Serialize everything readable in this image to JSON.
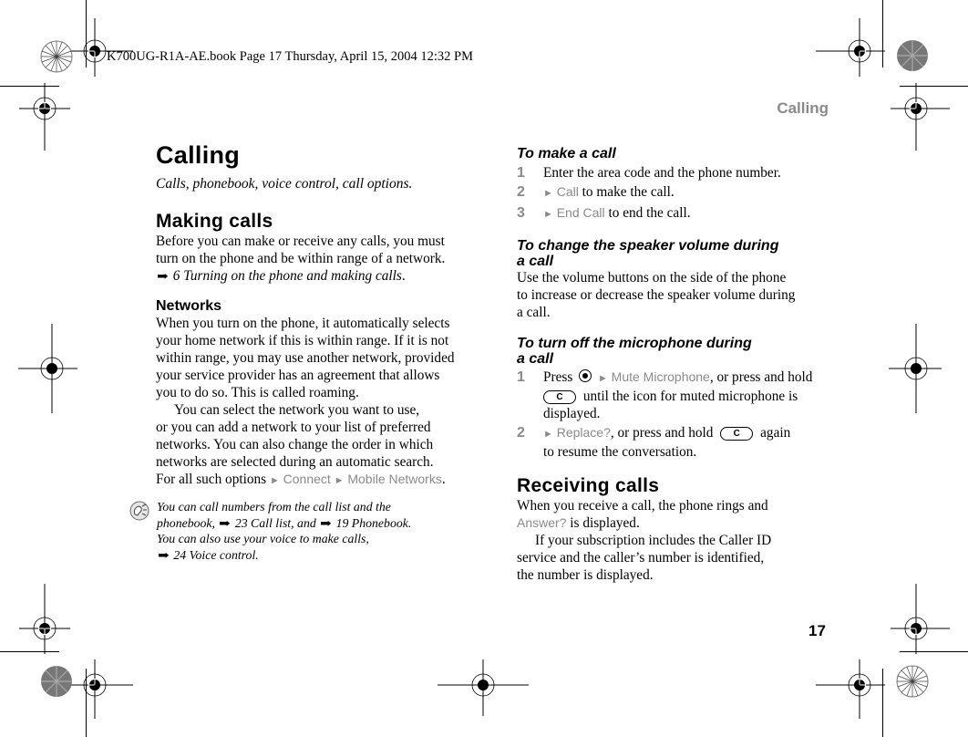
{
  "slug_line": "K700UG-R1A-AE.book  Page 17  Thursday, April 15, 2004  12:32 PM",
  "running_head": "Calling",
  "page_number": "17",
  "left_column": {
    "title": "Calling",
    "subtitle": "Calls, phonebook, voice control, call options.",
    "making_calls": {
      "heading": "Making calls",
      "body_line1": "Before you can make or receive any calls, you must",
      "body_line2": "turn on the phone and be within range of a network.",
      "xref": "6 Turning on the phone and making calls",
      "xref_end": "."
    },
    "networks": {
      "heading": "Networks",
      "para1": [
        "When you turn on the phone, it automatically selects",
        "your home network if this is within range. If it is not",
        "within range, you may use another network, provided",
        "your service provider has an agreement that allows",
        "you to do so. This is called roaming."
      ],
      "para2": [
        "You can select the network you want to use,",
        "or you can add a network to your list of preferred",
        "networks. You can also change the order in which",
        "networks are selected during an automatic search."
      ],
      "options_prefix": "For all such options",
      "menu_path": [
        "Connect",
        "Mobile Networks"
      ],
      "options_end": "."
    },
    "tip": {
      "icon": "tip-bulb-icon",
      "line1": "You can call numbers from the call list and the",
      "line2_prefix": "phonebook,",
      "xref1": "23 Call list,",
      "line2_mid": "and",
      "xref2": "19 Phonebook",
      "line2_end": ".",
      "line3": "You can also use your voice to make calls,",
      "xref3": "24 Voice control",
      "line4_end": "."
    }
  },
  "right_column": {
    "make_call": {
      "heading": "To make a call",
      "steps": [
        {
          "num": "1",
          "text": "Enter the area code and the phone number."
        },
        {
          "num": "2",
          "menu": "Call",
          "text": "to make the call."
        },
        {
          "num": "3",
          "menu": "End Call",
          "text": "to end the call."
        }
      ]
    },
    "speaker_volume": {
      "heading_line1": "To change the speaker volume during",
      "heading_line2": "a call",
      "body": [
        "Use the volume buttons on the side of the phone",
        "to increase or decrease the speaker volume during",
        "a call."
      ]
    },
    "microphone": {
      "heading_line1": "To turn off the microphone during",
      "heading_line2": "a call",
      "step1": {
        "num": "1",
        "press": "Press",
        "menu": "Mute Microphone",
        "rest": ", or press and hold",
        "key": "C",
        "line2": "until the icon for muted microphone is",
        "line3": "displayed."
      },
      "step2": {
        "num": "2",
        "menu": "Replace?",
        "rest": ", or press and hold",
        "key": "C",
        "again": "again",
        "line2": "to resume the conversation."
      }
    },
    "receiving": {
      "heading": "Receiving calls",
      "line1": "When you receive a call, the phone rings and",
      "answer_label": "Answer?",
      "line2_rest": "is displayed.",
      "para2": [
        "If your subscription includes the Caller ID",
        "service and the caller’s number is identified,",
        "the number is displayed."
      ]
    }
  },
  "glyphs": {
    "xref_arrow": "➡",
    "menu_arrow": "►"
  }
}
